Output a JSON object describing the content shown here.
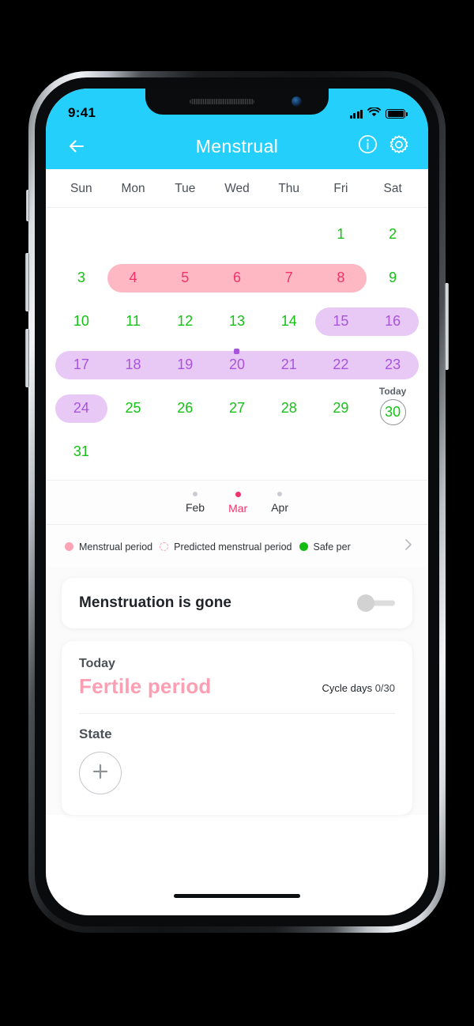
{
  "status_bar": {
    "time": "9:41",
    "icons": [
      "signal-bars-icon",
      "wifi-icon",
      "battery-icon"
    ]
  },
  "app_bar": {
    "back_icon": "back-arrow-icon",
    "title": "Menstrual",
    "info_icon": "info-icon",
    "settings_icon": "gear-icon",
    "background_color": "#25cffc"
  },
  "calendar": {
    "weekdays": [
      "Sun",
      "Mon",
      "Tue",
      "Wed",
      "Thu",
      "Fri",
      "Sat"
    ],
    "rows": [
      [
        {
          "day": "",
          "type": "empty"
        },
        {
          "day": "",
          "type": "empty"
        },
        {
          "day": "",
          "type": "empty"
        },
        {
          "day": "",
          "type": "empty"
        },
        {
          "day": "",
          "type": "empty"
        },
        {
          "day": "1",
          "type": "normal"
        },
        {
          "day": "2",
          "type": "normal"
        }
      ],
      [
        {
          "day": "3",
          "type": "normal"
        },
        {
          "day": "4",
          "type": "menstrual"
        },
        {
          "day": "5",
          "type": "menstrual"
        },
        {
          "day": "6",
          "type": "menstrual"
        },
        {
          "day": "7",
          "type": "menstrual"
        },
        {
          "day": "8",
          "type": "menstrual"
        },
        {
          "day": "9",
          "type": "normal"
        }
      ],
      [
        {
          "day": "10",
          "type": "normal"
        },
        {
          "day": "11",
          "type": "normal"
        },
        {
          "day": "12",
          "type": "normal"
        },
        {
          "day": "13",
          "type": "normal"
        },
        {
          "day": "14",
          "type": "normal"
        },
        {
          "day": "15",
          "type": "fertile"
        },
        {
          "day": "16",
          "type": "fertile"
        }
      ],
      [
        {
          "day": "17",
          "type": "fertile"
        },
        {
          "day": "18",
          "type": "fertile"
        },
        {
          "day": "19",
          "type": "fertile"
        },
        {
          "day": "20",
          "type": "fertile",
          "ovulation": true
        },
        {
          "day": "21",
          "type": "fertile"
        },
        {
          "day": "22",
          "type": "fertile"
        },
        {
          "day": "23",
          "type": "fertile"
        }
      ],
      [
        {
          "day": "24",
          "type": "fertile"
        },
        {
          "day": "25",
          "type": "normal"
        },
        {
          "day": "26",
          "type": "normal"
        },
        {
          "day": "27",
          "type": "normal"
        },
        {
          "day": "28",
          "type": "normal"
        },
        {
          "day": "29",
          "type": "normal"
        },
        {
          "day": "30",
          "type": "today",
          "today_label": "Today"
        }
      ],
      [
        {
          "day": "31",
          "type": "normal"
        },
        {
          "day": "",
          "type": "empty"
        },
        {
          "day": "",
          "type": "empty"
        },
        {
          "day": "",
          "type": "empty"
        },
        {
          "day": "",
          "type": "empty"
        },
        {
          "day": "",
          "type": "empty"
        },
        {
          "day": "",
          "type": "empty"
        }
      ]
    ],
    "highlights": [
      {
        "row": 1,
        "start": 1,
        "end": 5,
        "color": "pink"
      },
      {
        "row": 2,
        "start": 5,
        "end": 6,
        "color": "purple"
      },
      {
        "row": 3,
        "start": 0,
        "end": 6,
        "color": "purple"
      },
      {
        "row": 4,
        "start": 0,
        "end": 0,
        "color": "purple"
      }
    ],
    "colors": {
      "normal_day": "#16c116",
      "menstrual_day": "#f2336b",
      "menstrual_band": "#fdb8c4",
      "fertile_day": "#a855dd",
      "fertile_band": "#e8c8f5"
    }
  },
  "month_selector": {
    "months": [
      {
        "label": "Feb",
        "active": false
      },
      {
        "label": "Mar",
        "active": true
      },
      {
        "label": "Apr",
        "active": false
      }
    ]
  },
  "legend": {
    "items": [
      {
        "label": "Menstrual period",
        "marker": "dot-solid-pink"
      },
      {
        "label": "Predicted menstrual period",
        "marker": "dot-dashed-pink"
      },
      {
        "label": "Safe per",
        "marker": "dot-solid-green"
      }
    ],
    "more_icon": "chevron-right-icon"
  },
  "toggle_card": {
    "label": "Menstruation is gone",
    "toggle_state": "off"
  },
  "status_card": {
    "today_label": "Today",
    "phase": "Fertile period",
    "cycle_days_label": "Cycle days",
    "cycle_days_value": "0/30",
    "state_label": "State",
    "add_icon": "plus-icon"
  }
}
